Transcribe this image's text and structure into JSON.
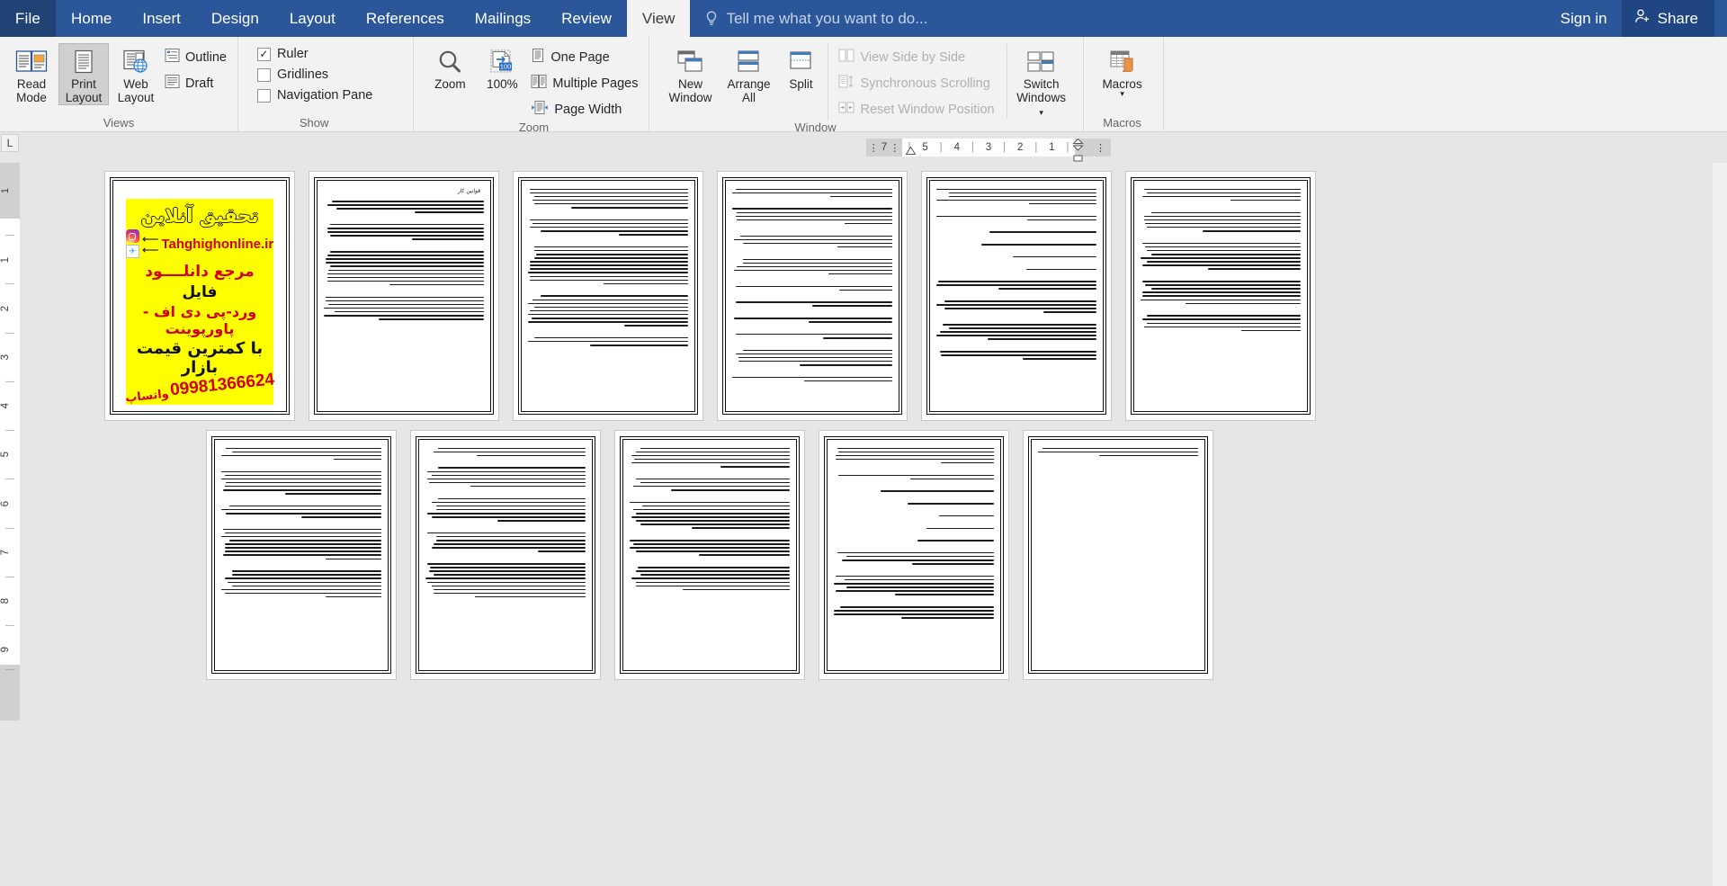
{
  "titlebar": {
    "file_tab": "File",
    "tabs": [
      {
        "label": "Home",
        "active": false
      },
      {
        "label": "Insert",
        "active": false
      },
      {
        "label": "Design",
        "active": false
      },
      {
        "label": "Layout",
        "active": false
      },
      {
        "label": "References",
        "active": false
      },
      {
        "label": "Mailings",
        "active": false
      },
      {
        "label": "Review",
        "active": false
      },
      {
        "label": "View",
        "active": true
      }
    ],
    "tell_me": "Tell me what you want to do...",
    "tell_me_icon": "lightbulb-icon",
    "sign_in": "Sign in",
    "share": "Share",
    "share_icon": "person-add-icon",
    "accent_color": "#2b579a",
    "active_tab_bg": "#f2f2f2"
  },
  "ribbon": {
    "groups": [
      {
        "name": "Views",
        "title": "Views",
        "big_buttons": [
          {
            "line1": "Read",
            "line2": "Mode",
            "selected": false,
            "icon": "read-mode-icon"
          },
          {
            "line1": "Print",
            "line2": "Layout",
            "selected": true,
            "icon": "print-layout-icon"
          },
          {
            "line1": "Web",
            "line2": "Layout",
            "selected": false,
            "icon": "web-layout-icon"
          }
        ],
        "small_buttons": [
          {
            "label": "Outline",
            "icon": "outline-icon",
            "disabled": false
          },
          {
            "label": "Draft",
            "icon": "draft-icon",
            "disabled": false
          }
        ]
      },
      {
        "name": "Show",
        "title": "Show",
        "checkboxes": [
          {
            "label": "Ruler",
            "checked": true
          },
          {
            "label": "Gridlines",
            "checked": false
          },
          {
            "label": "Navigation Pane",
            "checked": false
          }
        ]
      },
      {
        "name": "Zoom",
        "title": "Zoom",
        "big_buttons": [
          {
            "line1": "Zoom",
            "line2": "",
            "selected": false,
            "icon": "magnifier-icon"
          },
          {
            "line1": "100%",
            "line2": "",
            "selected": false,
            "icon": "zoom-100-icon"
          }
        ],
        "small_buttons": [
          {
            "label": "One Page",
            "icon": "one-page-icon",
            "disabled": false
          },
          {
            "label": "Multiple Pages",
            "icon": "multiple-pages-icon",
            "disabled": false
          },
          {
            "label": "Page Width",
            "icon": "page-width-icon",
            "disabled": false
          }
        ]
      },
      {
        "name": "Window",
        "title": "Window",
        "big_buttons": [
          {
            "line1": "New",
            "line2": "Window",
            "selected": false,
            "icon": "new-window-icon"
          },
          {
            "line1": "Arrange",
            "line2": "All",
            "selected": false,
            "icon": "arrange-all-icon"
          },
          {
            "line1": "Split",
            "line2": "",
            "selected": false,
            "icon": "split-icon"
          }
        ],
        "small_buttons": [
          {
            "label": "View Side by Side",
            "icon": "side-by-side-icon",
            "disabled": true
          },
          {
            "label": "Synchronous Scrolling",
            "icon": "sync-scroll-icon",
            "disabled": true
          },
          {
            "label": "Reset Window Position",
            "icon": "reset-window-icon",
            "disabled": true
          }
        ],
        "big_buttons2": [
          {
            "line1": "Switch",
            "line2": "Windows",
            "caret": true,
            "icon": "switch-windows-icon"
          }
        ]
      },
      {
        "name": "Macros",
        "title": "Macros",
        "big_buttons": [
          {
            "line1": "Macros",
            "line2": "",
            "caret": true,
            "icon": "macros-icon"
          }
        ]
      }
    ],
    "collapse_ribbon_icon": "chevron-up-icon"
  },
  "rulers": {
    "corner_tab_stop": "L",
    "horizontal_ticks": [
      "7",
      "5",
      "4",
      "3",
      "2",
      "1"
    ],
    "vertical_ticks": [
      "1",
      "1",
      "2",
      "3",
      "4",
      "5",
      "6",
      "7",
      "8",
      "9"
    ]
  },
  "document": {
    "zoom_mode": "Multiple Pages",
    "ad": {
      "headline": "تحقیق آنلاین",
      "url": "Tahghighonline.ir",
      "instagram_icon": "instagram-icon",
      "telegram_icon": "telegram-icon",
      "arrow_icon": "arrow-left-icon",
      "line2": "مرجع دانلــــود",
      "line3": "فایل",
      "line4": "ورد-پی دی اف - پاورپوینت",
      "line5": "با کمترین قیمت بازار",
      "phone": "09981366624",
      "whatsapp": "واتساپ",
      "bg_color": "#ffff00",
      "accent_color": "#d40000"
    },
    "pages": [
      {
        "index": 1,
        "kind": "cover",
        "title": "",
        "paragraphs": []
      },
      {
        "index": 2,
        "kind": "text",
        "title": "قوانین کار",
        "paragraphs": [
          {
            "lines": 4,
            "label": "ماده1- کلیه کارفرمایان، کارگران، کارگاهها، موسسات تولیدی، صنعتی، خدماتی و کشاورزی مکلف به تبعیت از این قانون می باشند."
          },
          {
            "lines": 5,
            "label": "ماده2- کارگر از لحاظ این قانون کسی است که به هر عنوان در مقابل دریافت حق السعی اعم از مزد، حقوق، سهم سود و سایر مزایا به درخواست کارفرما کار می کند."
          },
          {
            "lines": 10,
            "label": "ماده3- کارفرما شخص است حقیقی یا حقوقی که کارگر به درخواست و به حساب او در مقابل دریافت حق السعی کار می کند."
          },
          {
            "lines": 7,
            "label": "ماده4- کارگاه محلی است که کارگر به درخواست کارفرما یا نماینده او در آنجا کار می کند."
          }
        ]
      },
      {
        "index": 3,
        "kind": "text",
        "title": "",
        "paragraphs": [
          {
            "lines": 6
          },
          {
            "lines": 5
          },
          {
            "lines": 11
          },
          {
            "lines": 9
          },
          {
            "lines": 3
          }
        ]
      },
      {
        "index": 4,
        "kind": "text",
        "title": "",
        "paragraphs": [
          {
            "lines": 3
          },
          {
            "lines": 5
          },
          {
            "lines": 4
          },
          {
            "lines": 5
          },
          {
            "lines": 2
          },
          {
            "lines": 2
          },
          {
            "lines": 2
          },
          {
            "lines": 2
          },
          {
            "lines": 5
          },
          {
            "lines": 2
          }
        ]
      },
      {
        "index": 5,
        "kind": "text",
        "title": "",
        "paragraphs": [
          {
            "lines": 5
          },
          {
            "lines": 2
          },
          {
            "lines": 1
          },
          {
            "lines": 1
          },
          {
            "lines": 1
          },
          {
            "lines": 1
          },
          {
            "lines": 3
          },
          {
            "lines": 4
          },
          {
            "lines": 5
          },
          {
            "lines": 3
          }
        ]
      },
      {
        "index": 6,
        "kind": "text",
        "title": "",
        "paragraphs": [
          {
            "lines": 4
          },
          {
            "lines": 6
          },
          {
            "lines": 8
          },
          {
            "lines": 7
          },
          {
            "lines": 5
          }
        ]
      },
      {
        "index": 7,
        "kind": "text",
        "title": "",
        "paragraphs": [
          {
            "lines": 4
          },
          {
            "lines": 7
          },
          {
            "lines": 4
          },
          {
            "lines": 9
          },
          {
            "lines": 8
          }
        ]
      },
      {
        "index": 8,
        "kind": "text",
        "title": "",
        "paragraphs": [
          {
            "lines": 3
          },
          {
            "lines": 6
          },
          {
            "lines": 7
          },
          {
            "lines": 6
          },
          {
            "lines": 10
          }
        ]
      },
      {
        "index": 9,
        "kind": "text",
        "title": "",
        "paragraphs": [
          {
            "lines": 6
          },
          {
            "lines": 4
          },
          {
            "lines": 8
          },
          {
            "lines": 5
          },
          {
            "lines": 7
          }
        ]
      },
      {
        "index": 10,
        "kind": "text",
        "title": "",
        "paragraphs": [
          {
            "lines": 5
          },
          {
            "lines": 2
          },
          {
            "lines": 1
          },
          {
            "lines": 1
          },
          {
            "lines": 1
          },
          {
            "lines": 1
          },
          {
            "lines": 1
          },
          {
            "lines": 4
          },
          {
            "lines": 6
          },
          {
            "lines": 4
          }
        ]
      },
      {
        "index": 11,
        "kind": "text",
        "title": "",
        "paragraphs": [
          {
            "lines": 3
          }
        ]
      }
    ]
  }
}
